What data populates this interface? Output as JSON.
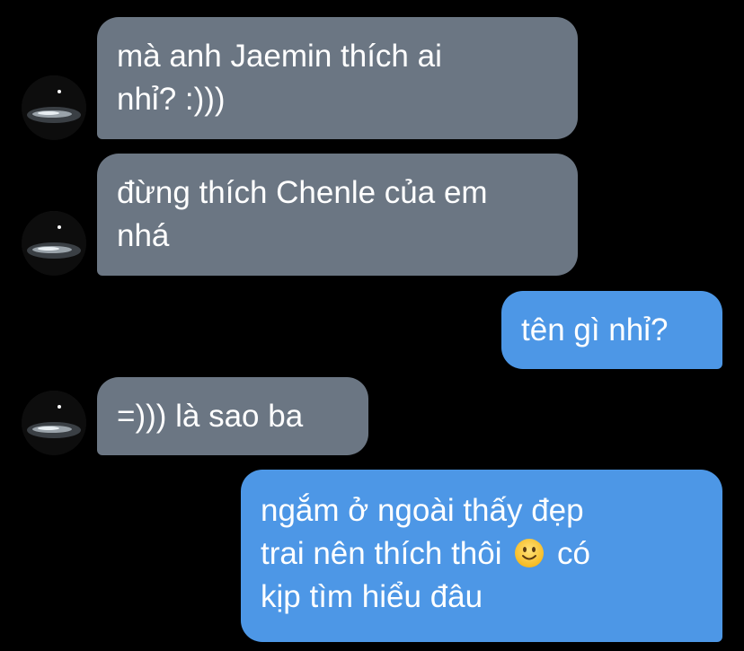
{
  "messages": [
    {
      "side": "incoming",
      "lines": [
        "mà anh Jaemin thích ai",
        "nhỉ? :)))"
      ]
    },
    {
      "side": "incoming",
      "lines": [
        "đừng thích Chenle của em",
        "nhá"
      ]
    },
    {
      "side": "outgoing",
      "lines": [
        "tên gì nhỉ?"
      ]
    },
    {
      "side": "incoming",
      "lines": [
        "=))) là sao ba"
      ]
    },
    {
      "side": "outgoing",
      "lines_before_emoji": "trai nên thích thôi",
      "line1": "ngắm ở ngoài thấy đẹp",
      "line2_after_emoji": "có",
      "line3": "kịp tìm hiểu đâu",
      "emoji": "slightly-smiling-face-icon"
    }
  ],
  "colors": {
    "background": "#000000",
    "incoming_bubble": "#6b7683",
    "outgoing_bubble": "#4d97e6",
    "text": "#ffffff"
  }
}
